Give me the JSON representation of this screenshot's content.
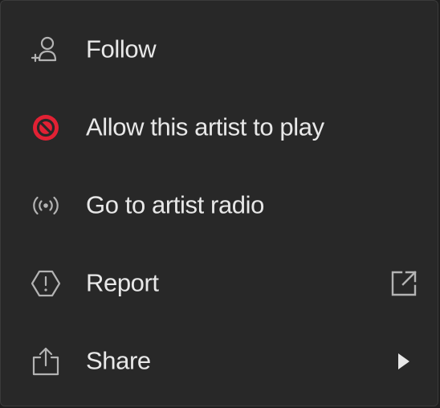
{
  "menu": {
    "items": [
      {
        "label": "Follow",
        "icon": "add-user-icon"
      },
      {
        "label": "Allow this artist to play",
        "icon": "blocked-icon",
        "icon_color": "#e22134"
      },
      {
        "label": "Go to artist radio",
        "icon": "radio-broadcast-icon"
      },
      {
        "label": "Report",
        "icon": "report-flag-icon",
        "trailing_icon": "external-link-icon"
      },
      {
        "label": "Share",
        "icon": "share-icon",
        "trailing_icon": "submenu-arrow-icon"
      }
    ]
  },
  "colors": {
    "background": "#282828",
    "text": "#e8e8e8",
    "icon": "#b3b3b3",
    "danger": "#e22134"
  }
}
